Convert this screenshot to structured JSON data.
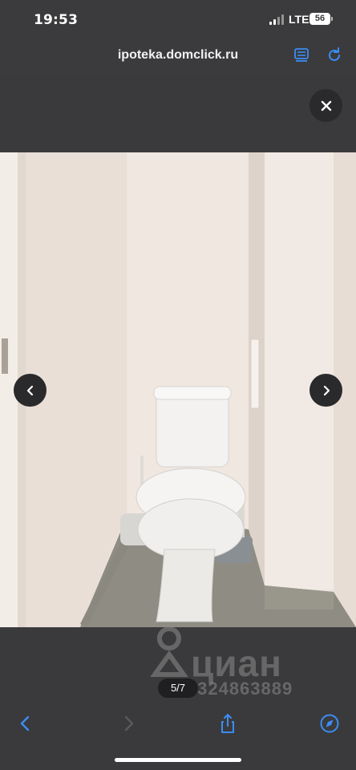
{
  "status_bar": {
    "time": "19:53",
    "network": "LTE",
    "battery": "56"
  },
  "browser": {
    "url": "ipoteka.domclick.ru",
    "icons": {
      "reader": "reader-mode-icon",
      "reload": "reload-icon"
    },
    "accent_color": "#3a8df5"
  },
  "gallery": {
    "counter": "5/7",
    "watermark": {
      "brand": "циан",
      "id": "ID 324863889"
    },
    "buttons": {
      "close": "close-icon",
      "prev": "chevron-left-icon",
      "next": "chevron-right-icon"
    }
  },
  "toolbar": {
    "back": "back-chevron-icon",
    "forward": "forward-chevron-icon",
    "share": "share-icon",
    "compass": "compass-icon"
  }
}
